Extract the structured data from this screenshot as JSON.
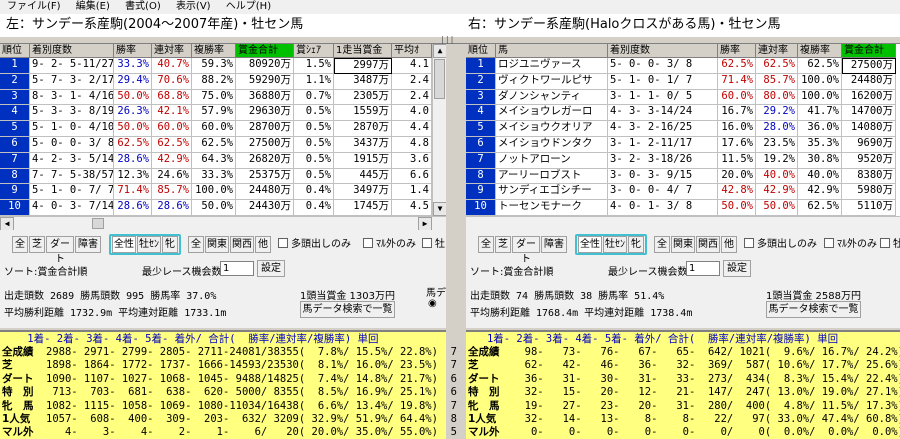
{
  "menu": [
    "ファイル(F)",
    "編集(E)",
    "書式(O)",
    "表示(V)",
    "ヘルプ(H)"
  ],
  "left_title": "左：サンデー系産駒(2004～2007年産)・牡セン馬",
  "right_title": "右：サンデー系産駒(Haloクロスがある馬)・牡セン馬",
  "left": {
    "headers": [
      "順位",
      "着別度数",
      "勝率",
      "連対率",
      "複勝率",
      "賞金合計",
      "賞ｼｪｱ",
      "1走当賞金",
      "平均ｵ"
    ],
    "rows": [
      [
        "1",
        "9- 2- 5-11/27",
        "33.3%",
        "40.7%",
        "59.3%",
        "80920万",
        "1.5%",
        "2997万",
        "4.1"
      ],
      [
        "2",
        "5- 7- 3- 2/17",
        "29.4%",
        "70.6%",
        "88.2%",
        "59290万",
        "1.1%",
        "3487万",
        "2.4"
      ],
      [
        "3",
        "8- 3- 1- 4/16",
        "50.0%",
        "68.8%",
        "75.0%",
        "36880万",
        "0.7%",
        "2305万",
        "2.4"
      ],
      [
        "4",
        "5- 3- 3- 8/19",
        "26.3%",
        "42.1%",
        "57.9%",
        "29630万",
        "0.5%",
        "1559万",
        "4.0"
      ],
      [
        "5",
        "5- 1- 0- 4/10",
        "50.0%",
        "60.0%",
        "60.0%",
        "28700万",
        "0.5%",
        "2870万",
        "4.4"
      ],
      [
        "6",
        "5- 0- 0- 3/ 8",
        "62.5%",
        "62.5%",
        "62.5%",
        "27500万",
        "0.5%",
        "3437万",
        "4.8"
      ],
      [
        "7",
        "4- 2- 3- 5/14",
        "28.6%",
        "42.9%",
        "64.3%",
        "26820万",
        "0.5%",
        "1915万",
        "3.6"
      ],
      [
        "8",
        "7- 7- 5-38/57",
        "12.3%",
        "24.6%",
        "33.3%",
        "25375万",
        "0.5%",
        "445万",
        "6.6"
      ],
      [
        "9",
        "5- 1- 0- 7/ 7",
        "71.4%",
        "85.7%",
        "100.0%",
        "24480万",
        "0.4%",
        "3497万",
        "1.4"
      ],
      [
        "10",
        "4- 0- 3- 7/14",
        "28.6%",
        "28.6%",
        "50.0%",
        "24430万",
        "0.4%",
        "1745万",
        "4.5"
      ]
    ],
    "surface_buttons": [
      "全",
      "芝",
      "ダート",
      "障害"
    ],
    "sex_buttons": [
      "全性",
      "牡ｾﾝ",
      "牝"
    ],
    "course_buttons": [
      "全",
      "関東",
      "関西",
      "他"
    ],
    "checks": [
      "多頭出しのみ",
      "ﾏﾙ外のみ",
      "牡"
    ],
    "sort_label": "ソート:賞金合計順",
    "min_race_label": "最少レース機会数",
    "min_race_value": "1",
    "set_button": "設定",
    "stats1": "出走頭数 2689   勝馬頭数 995    勝馬率  37.0%",
    "stats1b": "1頭当賞金 1303万円",
    "stats2": "平均勝利距離 1732.9m   平均連対距離  1733.1m",
    "search_button": "馬データ検索で一覧",
    "side_label": "馬デ",
    "summary_header": "    1着- 2着- 3着- 4着- 5着- 着外/ 合計(  勝率/連対率/複勝率) 単回",
    "summary": [
      [
        "全成績",
        "2988- 2971- 2799- 2805- 2711-24081/38355(  7.8%/ 15.5%/ 22.8%)  7"
      ],
      [
        "芝",
        "1898- 1864- 1772- 1737- 1666-14593/23530(  8.1%/ 16.0%/ 23.5%)  7"
      ],
      [
        "ダート",
        "1090- 1107- 1027- 1068- 1045- 9488/14825(  7.4%/ 14.8%/ 21.7%)  6"
      ],
      [
        "特　別",
        " 713-  703-  681-  638-  620- 5000/ 8355(  8.5%/ 16.9%/ 25.1%)  6"
      ],
      [
        "牝　馬",
        "1082- 1115- 1058- 1069- 1080-11034/16438(  6.6%/ 13.4%/ 19.8%)  7"
      ],
      [
        "1人気",
        "1057-  608-  400-  309-  203-  632/ 3209( 32.9%/ 51.9%/ 64.4%)  8"
      ],
      [
        "マル外",
        "   4-    3-    4-    2-    1-    6/   20( 20.0%/ 35.0%/ 55.0%)  5"
      ]
    ]
  },
  "right": {
    "headers": [
      "順位",
      "馬",
      "着別度数",
      "勝率",
      "連対率",
      "複勝率",
      "賞金合計"
    ],
    "rows": [
      [
        "1",
        "ロジユニヴァース",
        "5- 0- 0- 3/ 8",
        "62.5%",
        "62.5%",
        "62.5%",
        "27500万"
      ],
      [
        "2",
        "ヴィクトワールピサ",
        "5- 1- 0- 1/ 7",
        "71.4%",
        "85.7%",
        "100.0%",
        "24480万"
      ],
      [
        "3",
        "ダノンシャンティ",
        "3- 1- 1- 0/ 5",
        "60.0%",
        "80.0%",
        "100.0%",
        "16200万"
      ],
      [
        "4",
        "メイショウレガーロ",
        "4- 3- 3-14/24",
        "16.7%",
        "29.2%",
        "41.7%",
        "14700万"
      ],
      [
        "5",
        "メイショウクオリア",
        "4- 3- 2-16/25",
        "16.0%",
        "28.0%",
        "36.0%",
        "14080万"
      ],
      [
        "6",
        "メイショウドンタク",
        "3- 1- 2-11/17",
        "17.6%",
        "23.5%",
        "35.3%",
        "9690万"
      ],
      [
        "7",
        "ノットアローン",
        "3- 2- 3-18/26",
        "11.5%",
        "19.2%",
        "30.8%",
        "9520万"
      ],
      [
        "8",
        "アーリーロブスト",
        "3- 0- 3- 9/15",
        "20.0%",
        "40.0%",
        "40.0%",
        "8380万"
      ],
      [
        "9",
        "サンディエゴシチー",
        "3- 0- 0- 4/ 7",
        "42.8%",
        "42.9%",
        "42.9%",
        "5980万"
      ],
      [
        "10",
        "トーセンモナーク",
        "4- 0- 1- 3/ 8",
        "50.0%",
        "50.0%",
        "62.5%",
        "5110万"
      ]
    ],
    "surface_buttons": [
      "全",
      "芝",
      "ダート",
      "障害"
    ],
    "sex_buttons": [
      "全性",
      "牡ｾﾝ",
      "牝"
    ],
    "course_buttons": [
      "全",
      "関東",
      "関西",
      "他"
    ],
    "checks": [
      "多頭出しのみ",
      "ﾏﾙ外のみ",
      "牡"
    ],
    "sort_label": "ソート:賞金合計順",
    "min_race_label": "最少レース機会数",
    "min_race_value": "1",
    "set_button": "設定",
    "stats1": "出走頭数 74    勝馬頭数 38     勝馬率  51.4%",
    "stats1b": "1頭当賞金 2588万円",
    "stats2": "平均勝利距離 1768.4m   平均連対距離  1738.4m",
    "search_button": "馬データ検索で一覧",
    "summary_header": "   1着- 2着- 3着- 4着- 5着- 着外/ 合計(  勝率/連対率/複勝率) 単回",
    "summary": [
      [
        "全成績",
        "  98-   73-   76-   67-   65-  642/ 1021(  9.6%/ 16.7%/ 24.2%)"
      ],
      [
        "芝",
        "  62-   42-   46-   36-   32-  369/  587( 10.6%/ 17.7%/ 25.6%)"
      ],
      [
        "ダート",
        "  36-   31-   30-   31-   33-  273/  434(  8.3%/ 15.4%/ 22.4%)"
      ],
      [
        "特　別",
        "  32-   15-   20-   12-   21-  147/  247( 13.0%/ 19.0%/ 27.1%)"
      ],
      [
        "牝　馬",
        "  19-   27-   23-   20-   31-  280/  400(  4.8%/ 11.5%/ 17.3%)"
      ],
      [
        "1人気",
        "  32-   14-   13-    8-    8-   22/   97( 33.0%/ 47.4%/ 60.8%)"
      ],
      [
        "マル外",
        "   0-    0-    0-    0-    0-    0/    0(  0.0%/  0.0%/  0.0%)"
      ]
    ]
  }
}
